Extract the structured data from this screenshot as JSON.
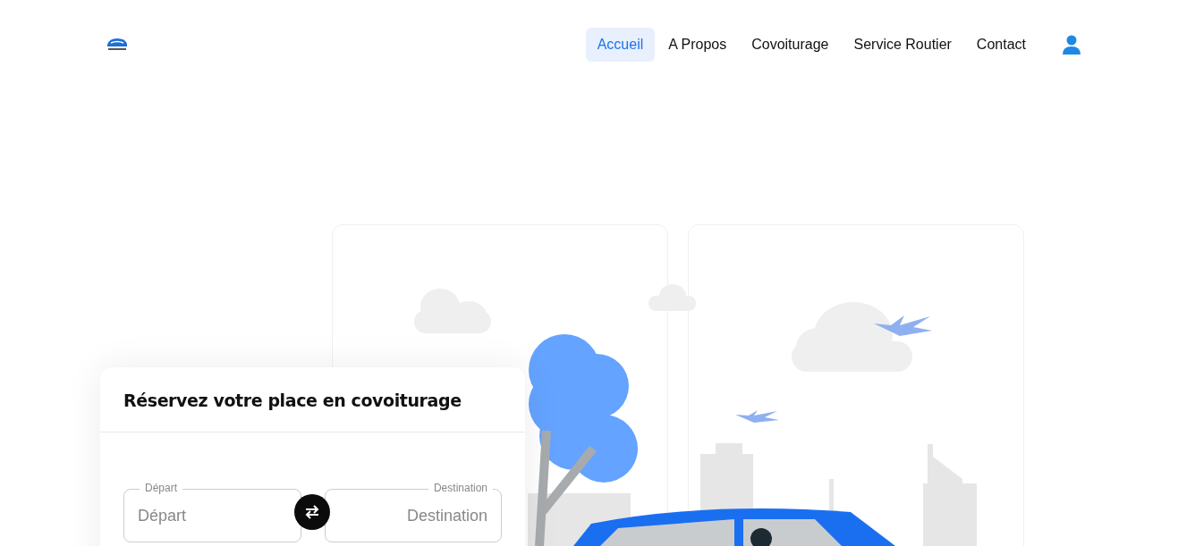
{
  "nav": {
    "items": [
      {
        "label": "Accueil",
        "selected": true
      },
      {
        "label": "A Propos",
        "selected": false
      },
      {
        "label": "Covoiturage",
        "selected": false
      },
      {
        "label": "Service Routier",
        "selected": false
      },
      {
        "label": "Contact",
        "selected": false
      }
    ]
  },
  "booking": {
    "title": "Réservez votre place en covoiturage",
    "fields": [
      {
        "label": "Départ",
        "placeholder": "Départ"
      },
      {
        "label": "Destination",
        "placeholder": "Destination"
      }
    ]
  }
}
